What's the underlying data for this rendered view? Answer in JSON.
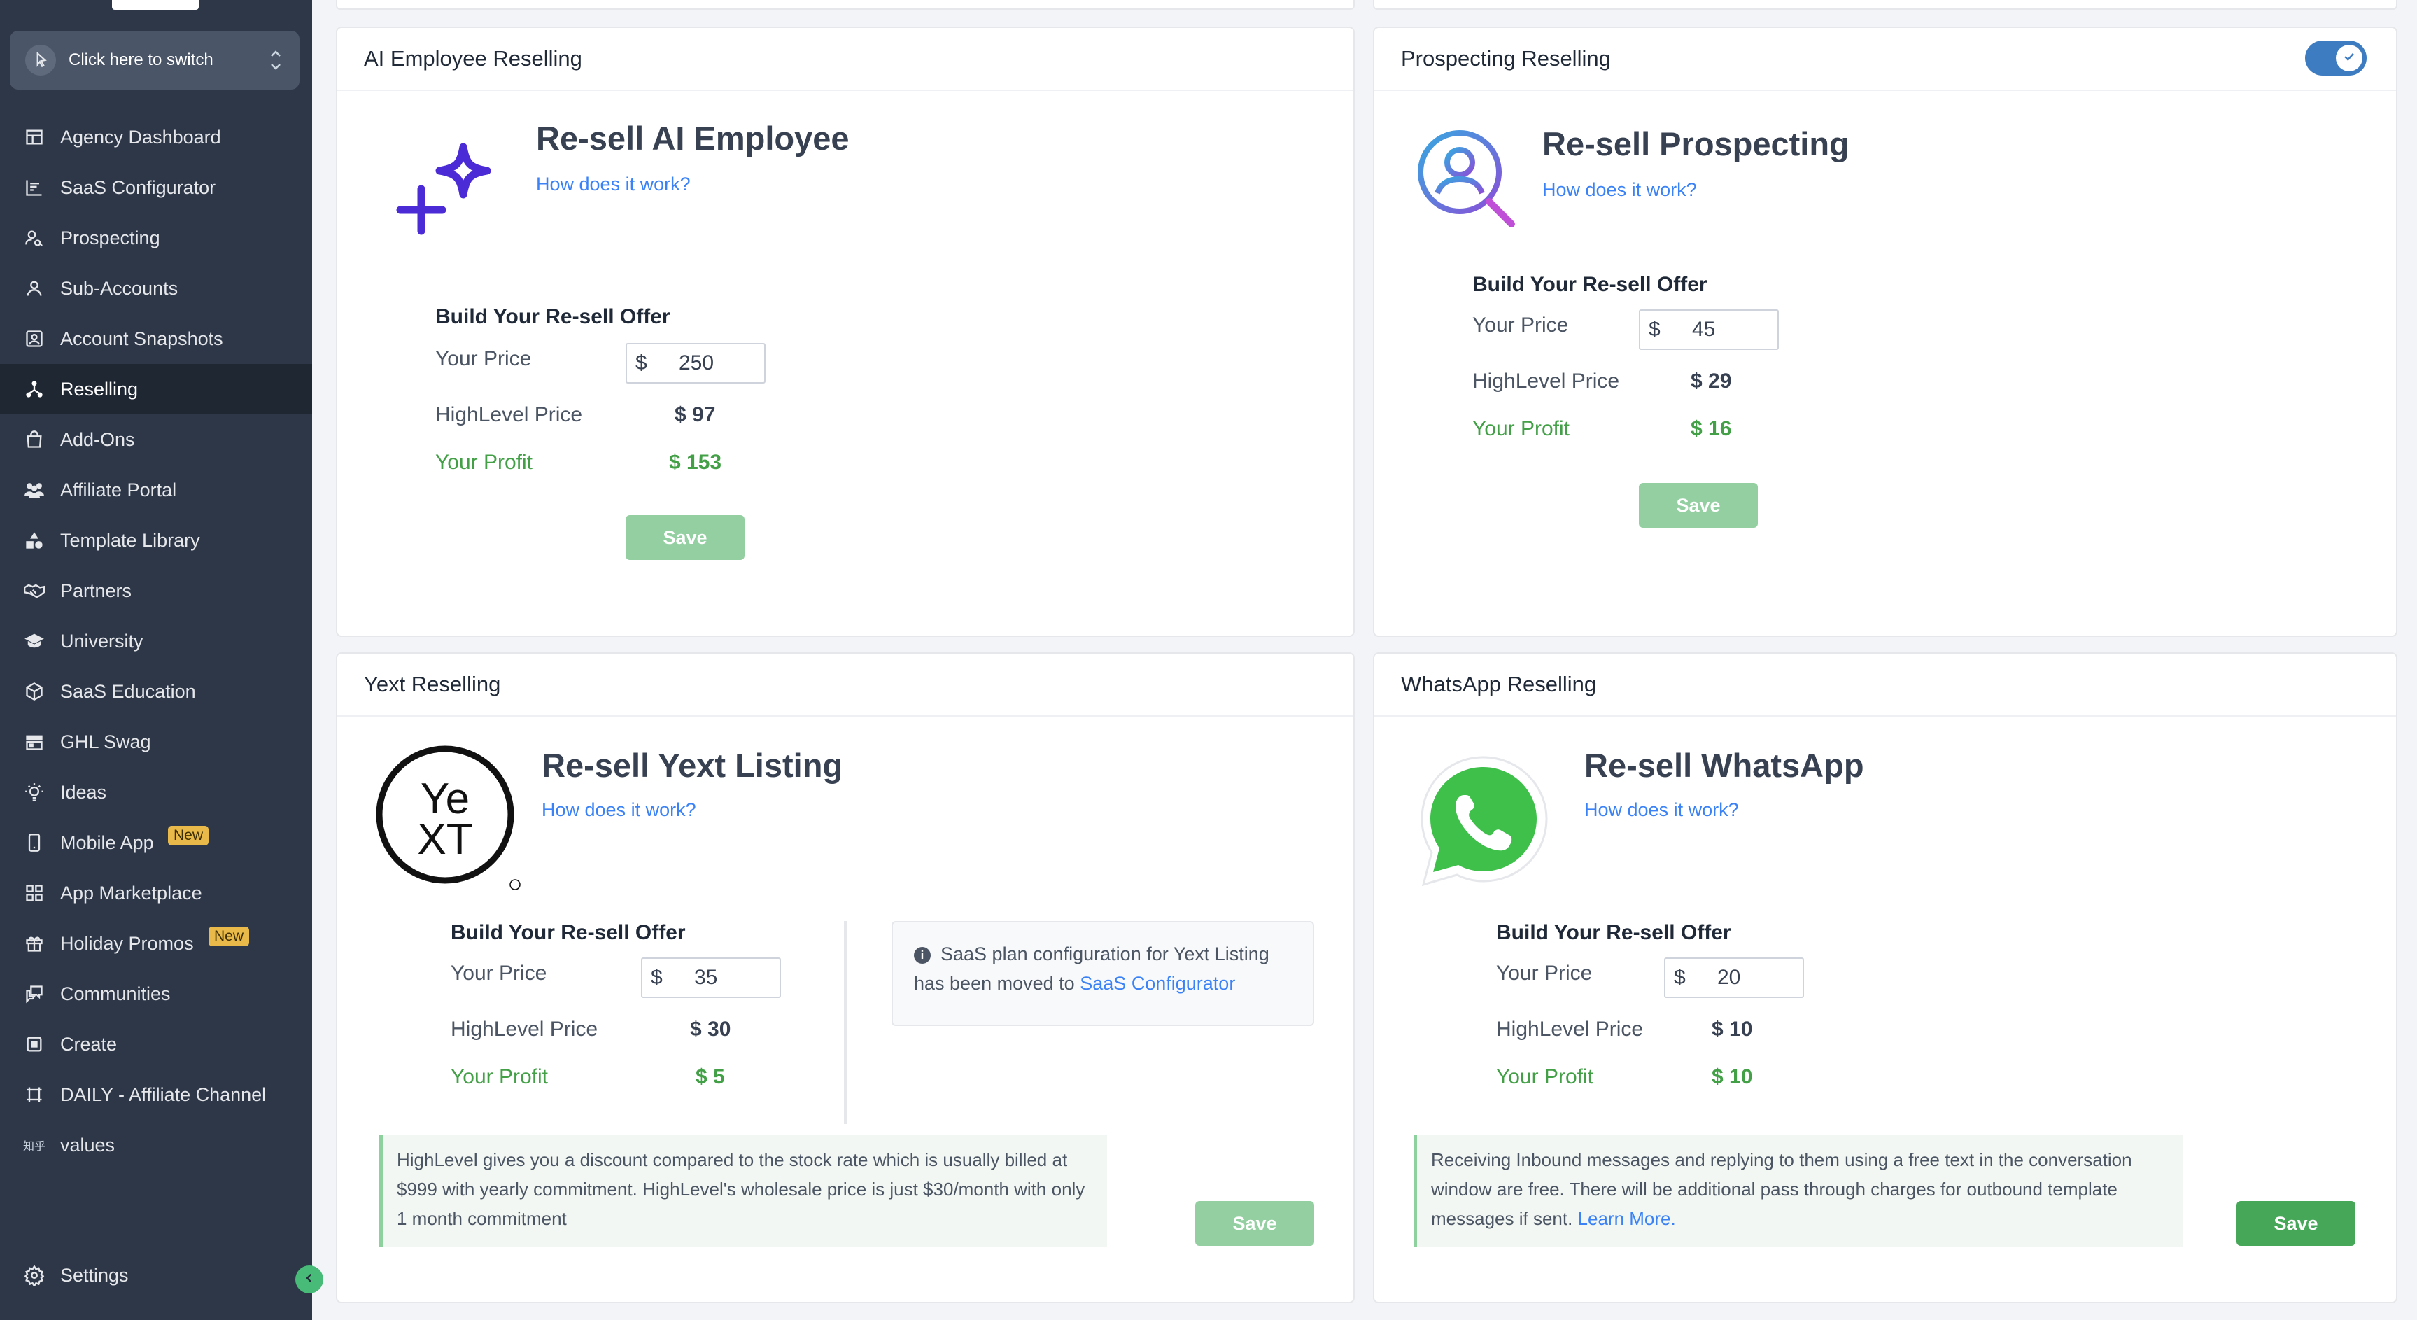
{
  "sidebar": {
    "switcher_label": "Click here to switch",
    "items": [
      {
        "label": "Agency Dashboard",
        "icon": "dashboard-icon"
      },
      {
        "label": "SaaS Configurator",
        "icon": "chart-icon"
      },
      {
        "label": "Prospecting",
        "icon": "user-search-icon"
      },
      {
        "label": "Sub-Accounts",
        "icon": "user-icon"
      },
      {
        "label": "Account Snapshots",
        "icon": "snapshot-icon"
      },
      {
        "label": "Reselling",
        "icon": "network-icon"
      },
      {
        "label": "Add-Ons",
        "icon": "bag-icon"
      },
      {
        "label": "Affiliate Portal",
        "icon": "users-icon"
      },
      {
        "label": "Template Library",
        "icon": "shapes-icon"
      },
      {
        "label": "Partners",
        "icon": "handshake-icon"
      },
      {
        "label": "University",
        "icon": "graduation-icon"
      },
      {
        "label": "SaaS Education",
        "icon": "box-icon"
      },
      {
        "label": "GHL Swag",
        "icon": "store-icon"
      },
      {
        "label": "Ideas",
        "icon": "bulb-icon"
      },
      {
        "label": "Mobile App",
        "icon": "phone-icon",
        "badge": "New"
      },
      {
        "label": "App Marketplace",
        "icon": "grid-icon"
      },
      {
        "label": "Holiday Promos",
        "icon": "gift-icon",
        "badge": "New"
      },
      {
        "label": "Communities",
        "icon": "chat-icon"
      },
      {
        "label": "Create",
        "icon": "create-icon"
      },
      {
        "label": "DAILY - Affiliate Channel",
        "icon": "frame-icon"
      },
      {
        "label": "values",
        "icon": "text-icon",
        "icon_text": "知乎"
      }
    ],
    "settings_label": "Settings",
    "accent": "#2d3748"
  },
  "cards": {
    "ai": {
      "header": "AI Employee Reselling",
      "title": "Re-sell AI Employee",
      "how_link": "How does it work?",
      "offer_title": "Build Your Re-sell Offer",
      "your_price_label": "Your Price",
      "currency": "$",
      "your_price_value": "250",
      "hl_price_label": "HighLevel Price",
      "hl_price_value": "$ 97",
      "profit_label": "Your Profit",
      "profit_value": "$ 153",
      "save_label": "Save"
    },
    "prospecting": {
      "header": "Prospecting Reselling",
      "toggle_on": true,
      "title": "Re-sell Prospecting",
      "how_link": "How does it work?",
      "offer_title": "Build Your Re-sell Offer",
      "your_price_label": "Your Price",
      "currency": "$",
      "your_price_value": "45",
      "hl_price_label": "HighLevel Price",
      "hl_price_value": "$ 29",
      "profit_label": "Your Profit",
      "profit_value": "$ 16",
      "save_label": "Save"
    },
    "yext": {
      "header": "Yext Reselling",
      "title": "Re-sell Yext Listing",
      "how_link": "How does it work?",
      "offer_title": "Build Your Re-sell Offer",
      "your_price_label": "Your Price",
      "currency": "$",
      "your_price_value": "35",
      "hl_price_label": "HighLevel Price",
      "hl_price_value": "$ 30",
      "profit_label": "Your Profit",
      "profit_value": "$ 5",
      "info_text": "SaaS plan configuration for Yext Listing has been moved to",
      "info_link": "SaaS Configurator",
      "note": "HighLevel gives you a discount compared to the stock rate which is usually billed at $999 with yearly commitment. HighLevel's wholesale price is just $30/month with only 1 month commitment",
      "save_label": "Save",
      "logo_text_top": "Ye",
      "logo_text_bottom": "XT"
    },
    "whatsapp": {
      "header": "WhatsApp Reselling",
      "title": "Re-sell WhatsApp",
      "how_link": "How does it work?",
      "offer_title": "Build Your Re-sell Offer",
      "your_price_label": "Your Price",
      "currency": "$",
      "your_price_value": "20",
      "hl_price_label": "HighLevel Price",
      "hl_price_value": "$ 10",
      "profit_label": "Your Profit",
      "profit_value": "$ 10",
      "note": "Receiving Inbound messages and replying to them using a free text in the conversation window are free. There will be additional pass through charges for outbound template messages if sent.",
      "note_link": "Learn More.",
      "save_label": "Save"
    }
  },
  "colors": {
    "profit_green": "#43a047",
    "link_blue": "#3b82f6",
    "save_enabled": "#46a758",
    "save_disabled": "#93cfa1"
  }
}
